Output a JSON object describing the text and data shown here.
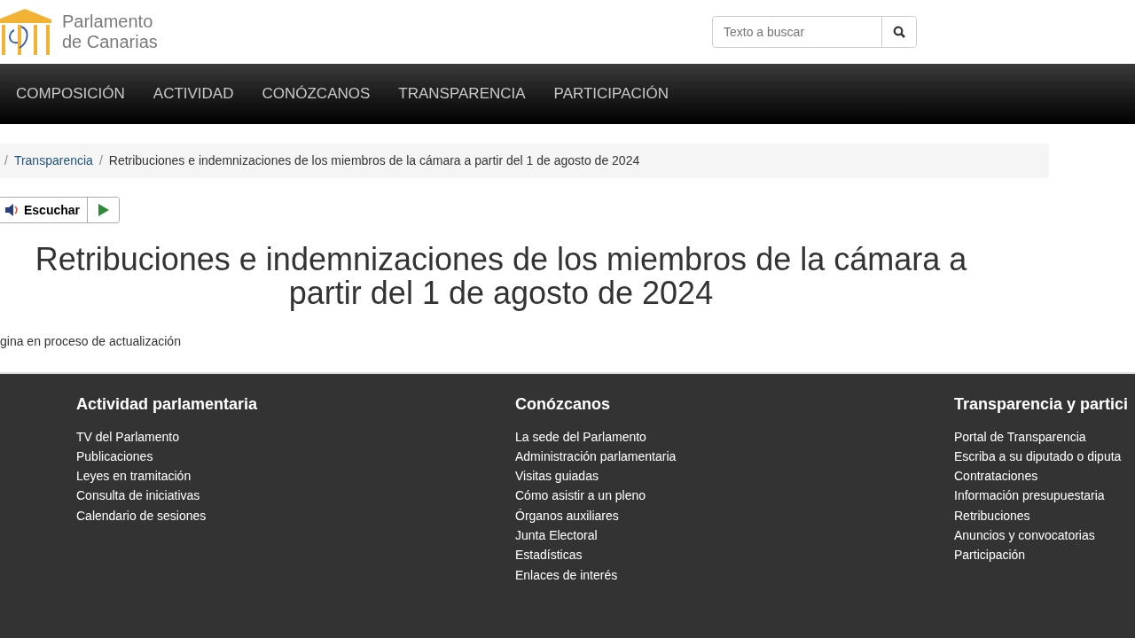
{
  "header": {
    "logo_text": [
      "Parlamento",
      "de Canarias"
    ],
    "search": {
      "placeholder": "Texto a buscar"
    }
  },
  "nav": {
    "items": [
      {
        "label": "COMPOSICIÓN"
      },
      {
        "label": "ACTIVIDAD"
      },
      {
        "label": "CONÓZCANOS"
      },
      {
        "label": "TRANSPARENCIA"
      },
      {
        "label": "PARTICIPACIÓN"
      }
    ]
  },
  "breadcrumb": {
    "separator": "/",
    "items": [
      {
        "label": "Transparencia",
        "link": true
      },
      {
        "label": "Retribuciones e indemnizaciones de los miembros de la cámara a partir del 1 de agosto de 2024",
        "link": false
      }
    ]
  },
  "listen": {
    "label": "Escuchar"
  },
  "title": "Retribuciones e indemnizaciones de los miembros de la cámara a partir del 1 de agosto de 2024",
  "note": "gina en proceso de actualización",
  "footer": {
    "columns": [
      {
        "heading": "Actividad parlamentaria",
        "links": [
          "TV del Parlamento",
          "Publicaciones",
          "Leyes en tramitación",
          "Consulta de iniciativas",
          "Calendario de sesiones"
        ]
      },
      {
        "heading": "Conózcanos",
        "links": [
          "La sede del Parlamento",
          "Administración parlamentaria",
          "Visitas guiadas",
          "Cómo asistir a un pleno",
          "Órganos auxiliares",
          "Junta Electoral",
          "Estadísticas",
          "Enlaces de interés"
        ]
      },
      {
        "heading": "Transparencia y partici",
        "links": [
          "Portal de Transparencia",
          "Escriba a su diputado o diputa",
          "Contrataciones",
          "Información presupuestaria",
          "Retribuciones",
          "Anuncios y convocatorias",
          "Participación"
        ]
      }
    ]
  }
}
